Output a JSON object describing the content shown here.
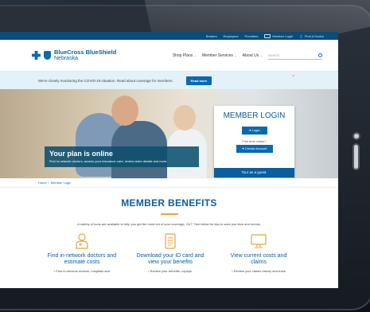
{
  "topbar": {
    "links": [
      "Brokers",
      "Employers",
      "Providers"
    ],
    "member_login": "Member Login",
    "find_doctor": "Find A Doctor"
  },
  "header": {
    "brand_line1": "BlueCross BlueShield",
    "brand_line2": "Nebraska",
    "nav": [
      "Shop Plans",
      "Member Services",
      "About Us"
    ],
    "search_placeholder": "Search"
  },
  "alert": {
    "text": "We're closely monitoring the COVID-19 situation. Read about coverage for members.",
    "button": "Read more",
    "close": "×"
  },
  "hero": {
    "title": "Your plan is online",
    "subtitle": "Find in-network doctors, access your insurance card, review claim details and more."
  },
  "login_card": {
    "title": "MEMBER LOGIN",
    "login_button": "➜ Login",
    "first_time": "First time visitor?",
    "create_button": "➜ Create Account",
    "guest": "Tour as a guest."
  },
  "breadcrumb": {
    "home": "Home",
    "sep": "/",
    "current": "Member Login"
  },
  "benefits": {
    "title": "MEMBER BENEFITS",
    "intro": "A variety of tools are available to help you get the most out of your coverage, 24/7. See below for tips to save you time and money.",
    "items": [
      {
        "title": "Find in-network doctors and estimate costs",
        "desc": "• Find in-network doctors, hospitals and",
        "icon": "doctor-icon"
      },
      {
        "title": "Download your ID card and view your benefits",
        "desc": "• Review your benefits, copays,",
        "icon": "id-card-icon"
      },
      {
        "title": "View current costs and claims",
        "desc": "• Review your claims history and track",
        "icon": "monitor-icon"
      }
    ]
  },
  "colors": {
    "brand": "#0a5d9e",
    "accent": "#e8a33d",
    "topbar": "#0a4c7a"
  }
}
